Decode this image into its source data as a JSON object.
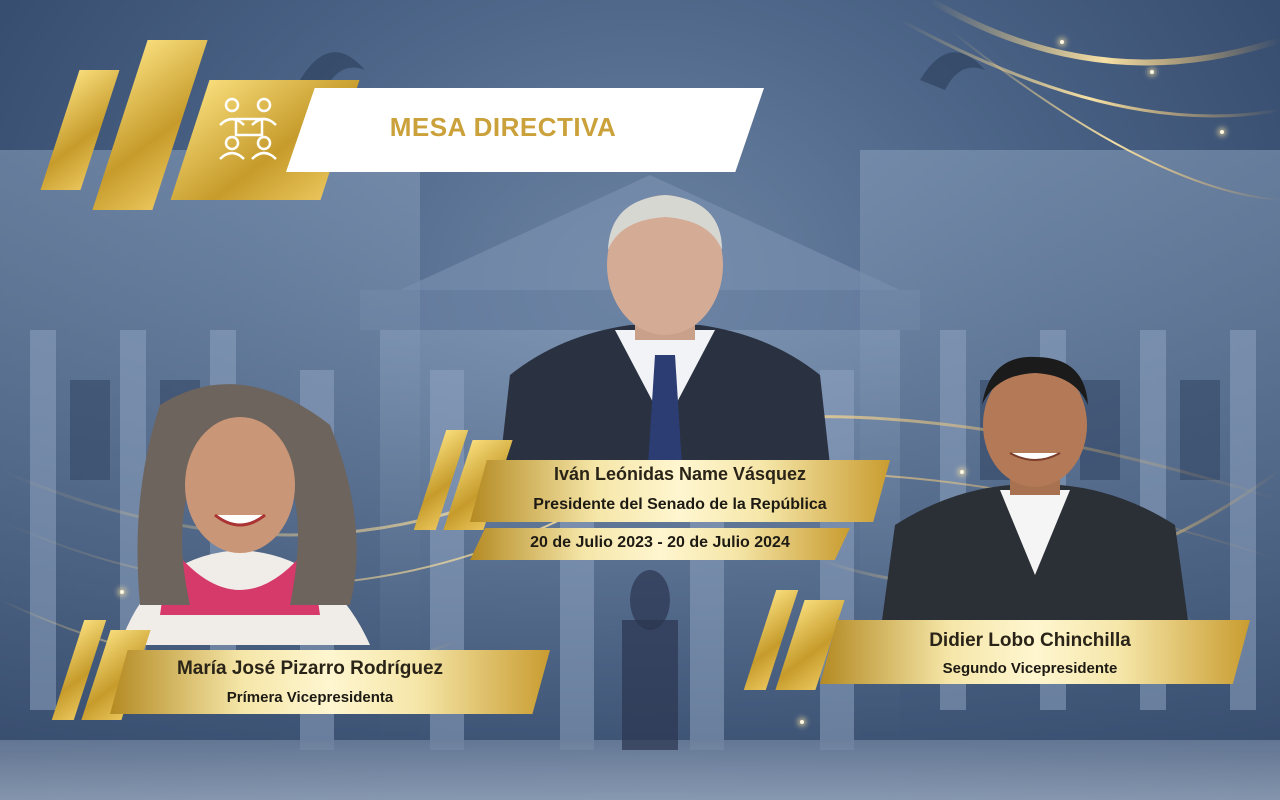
{
  "header": {
    "title": "MESA DIRECTIVA",
    "icon": "meeting-people-icon"
  },
  "president": {
    "name": "Iván Leónidas Name Vásquez",
    "role": "Presidente del Senado de la República",
    "period": "20 de Julio 2023  - 20 de Julio 2024"
  },
  "first_vp": {
    "name": "María José Pizarro Rodríguez",
    "role": "Prímera Vicepresidenta"
  },
  "second_vp": {
    "name": "Didier Lobo Chinchilla",
    "role": "Segundo Vicepresidente"
  },
  "colors": {
    "gold": "#caa13a",
    "gold_light": "#f5e6a8",
    "background": "#4a6386"
  }
}
